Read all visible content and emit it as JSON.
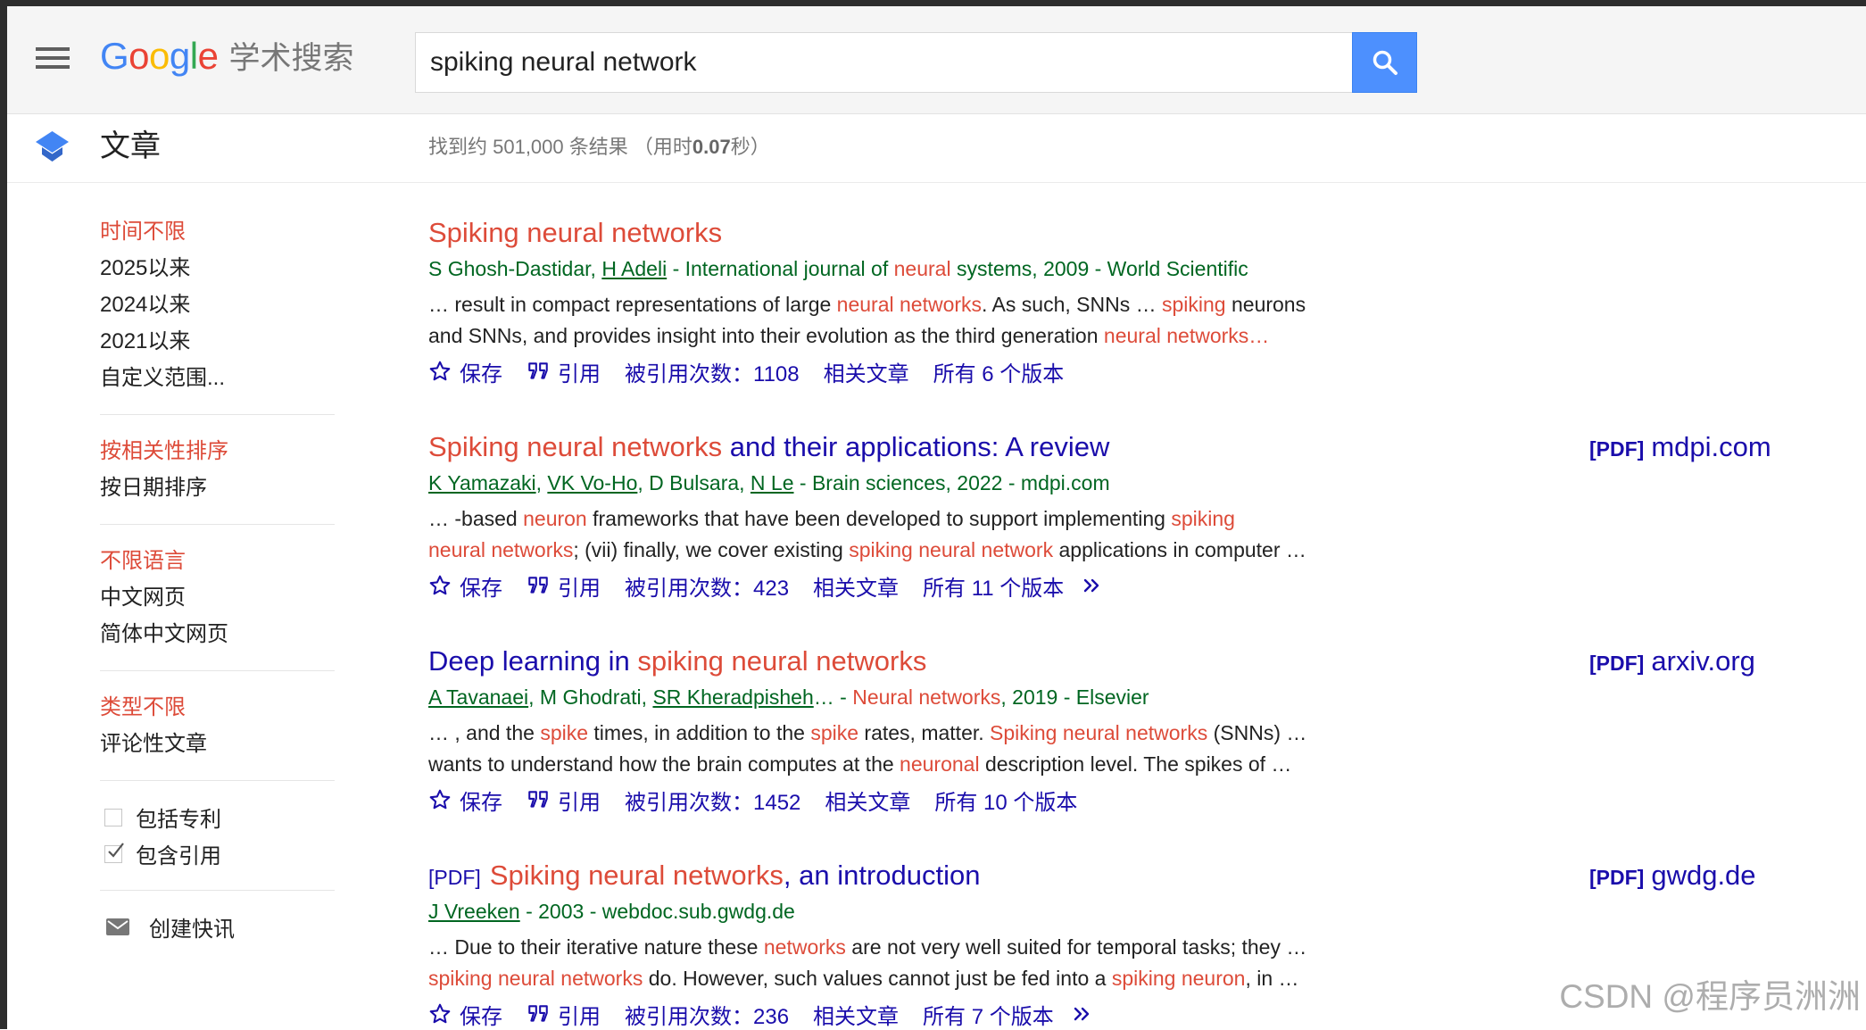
{
  "colors": {
    "frame": "#2d2d2d",
    "title": "#1a0dab",
    "highlight": "#dd4b39",
    "green": "#006621",
    "text": "#222222",
    "muted": "#777777",
    "accent": "#4d90fe"
  },
  "icons": {
    "save": "star-icon",
    "cite": "quote-icon",
    "more": "double-chevron-icon"
  },
  "header": {
    "menu_icon": "hamburger-menu-icon",
    "logo": {
      "letters": [
        {
          "ch": "G",
          "color": "#4285f4"
        },
        {
          "ch": "o",
          "color": "#ea4335"
        },
        {
          "ch": "o",
          "color": "#fbbc05"
        },
        {
          "ch": "g",
          "color": "#4285f4"
        },
        {
          "ch": "l",
          "color": "#34a853"
        },
        {
          "ch": "e",
          "color": "#ea4335"
        }
      ],
      "suffix": "学术搜索"
    },
    "search": {
      "value": "spiking neural network",
      "button_icon": "search-icon"
    }
  },
  "subheader": {
    "section_icon": "scholar-cap-icon",
    "section_title": "文章",
    "stats_prefix": "找到约 501,000 条结果 （用时",
    "stats_time": "0.07",
    "stats_suffix": "秒）"
  },
  "sidebar": {
    "filter_groups": [
      {
        "items": [
          {
            "label": "时间不限",
            "selected": true
          },
          {
            "label": "2025以来"
          },
          {
            "label": "2024以来"
          },
          {
            "label": "2021以来"
          },
          {
            "label": "自定义范围..."
          }
        ]
      },
      {
        "items": [
          {
            "label": "按相关性排序",
            "selected": true
          },
          {
            "label": "按日期排序"
          }
        ]
      },
      {
        "items": [
          {
            "label": "不限语言",
            "selected": true
          },
          {
            "label": "中文网页"
          },
          {
            "label": "简体中文网页"
          }
        ]
      },
      {
        "items": [
          {
            "label": "类型不限",
            "selected": true
          },
          {
            "label": "评论性文章"
          }
        ]
      }
    ],
    "checkboxes": [
      {
        "label": "包括专利",
        "checked": false
      },
      {
        "label": "包含引用",
        "checked": true
      }
    ],
    "alert": {
      "icon": "mail-icon",
      "label": "创建快讯"
    }
  },
  "results": [
    {
      "title": [
        {
          "t": "Spiking neural networks",
          "hl": true
        }
      ],
      "authors": [
        {
          "t": "S Ghosh-Dastidar, "
        },
        {
          "t": "H Adeli",
          "link": true
        },
        {
          "t": " - International journal of "
        },
        {
          "t": "neural",
          "hl": true
        },
        {
          "t": " systems, 2009 - World Scientific"
        }
      ],
      "snippet_lines": [
        [
          {
            "t": "… result in compact representations of large "
          },
          {
            "t": "neural networks",
            "hl": true
          },
          {
            "t": ". As such, SNNs … "
          },
          {
            "t": "spiking",
            "hl": true
          },
          {
            "t": " neurons"
          }
        ],
        [
          {
            "t": "and SNNs, and provides insight into their evolution as the third generation "
          },
          {
            "t": "neural networks…",
            "hl": true
          }
        ]
      ],
      "actions": {
        "save": "保存",
        "cite": "引用",
        "cited_by": "被引用次数：1108",
        "related": "相关文章",
        "versions": "所有 6 个版本",
        "more": false
      },
      "side_link": null
    },
    {
      "title": [
        {
          "t": "Spiking neural networks",
          "hl": true
        },
        {
          "t": " and their applications: A review"
        }
      ],
      "authors": [
        {
          "t": "K Yamazaki",
          "link": true
        },
        {
          "t": ", "
        },
        {
          "t": "VK Vo-Ho",
          "link": true
        },
        {
          "t": ", D Bulsara, "
        },
        {
          "t": "N Le",
          "link": true
        },
        {
          "t": " - Brain sciences, 2022 - mdpi.com"
        }
      ],
      "snippet_lines": [
        [
          {
            "t": "… -based "
          },
          {
            "t": "neuron",
            "hl": true
          },
          {
            "t": " frameworks that have been developed to support implementing "
          },
          {
            "t": "spiking",
            "hl": true
          }
        ],
        [
          {
            "t": "neural networks",
            "hl": true
          },
          {
            "t": "; (vii) finally, we cover existing "
          },
          {
            "t": "spiking neural network",
            "hl": true
          },
          {
            "t": " applications in computer …"
          }
        ]
      ],
      "actions": {
        "save": "保存",
        "cite": "引用",
        "cited_by": "被引用次数：423",
        "related": "相关文章",
        "versions": "所有 11 个版本",
        "more": true
      },
      "side_link": {
        "label": "[PDF]",
        "domain": "mdpi.com"
      }
    },
    {
      "title": [
        {
          "t": "Deep learning in "
        },
        {
          "t": "spiking neural networks",
          "hl": true
        }
      ],
      "authors": [
        {
          "t": "A Tavanaei",
          "link": true
        },
        {
          "t": ", M Ghodrati, "
        },
        {
          "t": "SR Kheradpisheh",
          "link": true
        },
        {
          "t": "… - "
        },
        {
          "t": "Neural networks",
          "hl": true
        },
        {
          "t": ", 2019 - Elsevier"
        }
      ],
      "snippet_lines": [
        [
          {
            "t": "… , and the "
          },
          {
            "t": "spike",
            "hl": true
          },
          {
            "t": " times, in addition to the "
          },
          {
            "t": "spike",
            "hl": true
          },
          {
            "t": " rates, matter. "
          },
          {
            "t": "Spiking neural networks",
            "hl": true
          },
          {
            "t": " (SNNs) …"
          }
        ],
        [
          {
            "t": "wants to understand how the brain computes at the "
          },
          {
            "t": "neuronal",
            "hl": true
          },
          {
            "t": " description level. The spikes of …"
          }
        ]
      ],
      "actions": {
        "save": "保存",
        "cite": "引用",
        "cited_by": "被引用次数：1452",
        "related": "相关文章",
        "versions": "所有 10 个版本",
        "more": false
      },
      "side_link": {
        "label": "[PDF]",
        "domain": "arxiv.org"
      }
    },
    {
      "title_prefix": "[PDF]",
      "title": [
        {
          "t": "Spiking neural networks",
          "hl": true
        },
        {
          "t": ", an introduction"
        }
      ],
      "authors": [
        {
          "t": "J Vreeken",
          "link": true
        },
        {
          "t": " - 2003 - webdoc.sub.gwdg.de"
        }
      ],
      "snippet_lines": [
        [
          {
            "t": "… Due to their iterative nature these "
          },
          {
            "t": "networks",
            "hl": true
          },
          {
            "t": " are not very well suited for temporal tasks; they …"
          }
        ],
        [
          {
            "t": "spiking neural networks",
            "hl": true
          },
          {
            "t": " do. However, such values cannot just be fed into a "
          },
          {
            "t": "spiking neuron",
            "hl": true
          },
          {
            "t": ", in …"
          }
        ]
      ],
      "actions": {
        "save": "保存",
        "cite": "引用",
        "cited_by": "被引用次数：236",
        "related": "相关文章",
        "versions": "所有 7 个版本",
        "more": true
      },
      "side_link": {
        "label": "[PDF]",
        "domain": "gwdg.de"
      }
    }
  ],
  "watermark": "CSDN @程序员洲洲"
}
